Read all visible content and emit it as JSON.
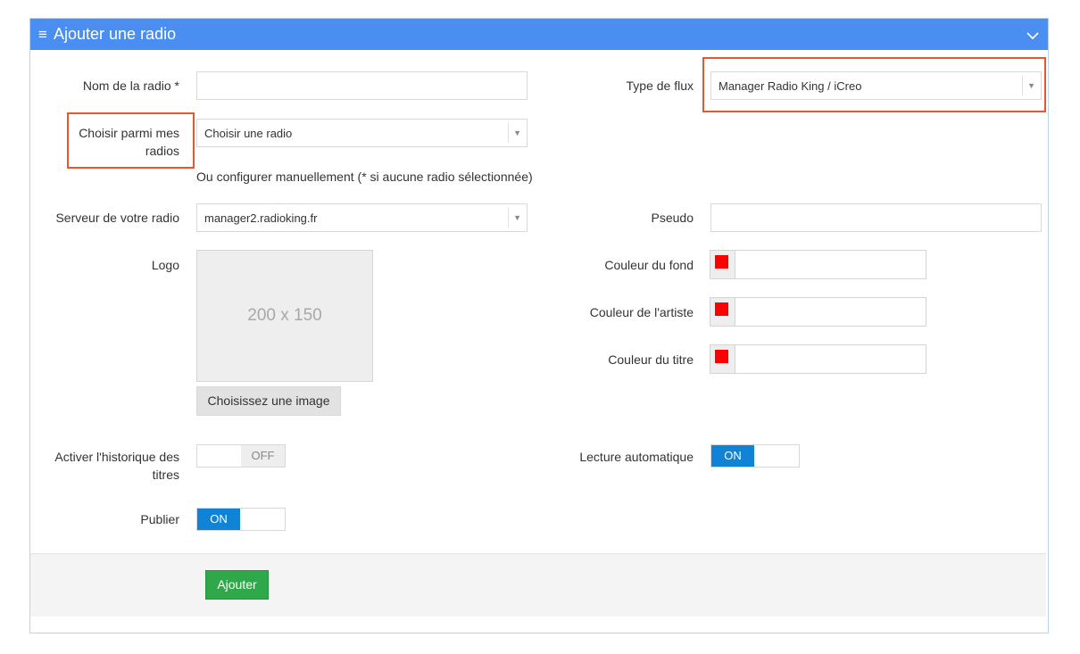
{
  "panel": {
    "title": "Ajouter une radio",
    "menu_icon": "hamburger-icon",
    "collapse_icon": "chevron-down-icon",
    "accent_color": "#4a8ef2"
  },
  "form": {
    "name_label": "Nom de la radio *",
    "name_value": "",
    "choose_label_line1": "Choisir parmi mes",
    "choose_label_line2": "radios",
    "choose_value": "Choisir une radio",
    "manual_note": "Ou configurer manuellement (* si aucune radio sélectionnée)",
    "server_label": "Serveur de votre radio",
    "server_value": "manager2.radioking.fr",
    "logo_label": "Logo",
    "logo_placeholder": "200 x 150",
    "logo_button": "Choisissez une image",
    "history_label_line1": "Activer l'historique des",
    "history_label_line2": "titres",
    "history_state": "OFF",
    "publish_label": "Publier",
    "publish_state": "ON",
    "flux_label": "Type de flux",
    "flux_value": "Manager Radio King / iCreo",
    "pseudo_label": "Pseudo",
    "pseudo_value": "",
    "bg_color_label": "Couleur du fond",
    "artist_color_label": "Couleur de l'artiste",
    "title_color_label": "Couleur du titre",
    "swatch_color": "#ff0000",
    "autoplay_label": "Lecture automatique",
    "autoplay_state": "ON"
  },
  "footer": {
    "submit_label": "Ajouter",
    "submit_color": "#2fa84a"
  },
  "highlight_color": "#e8572c"
}
